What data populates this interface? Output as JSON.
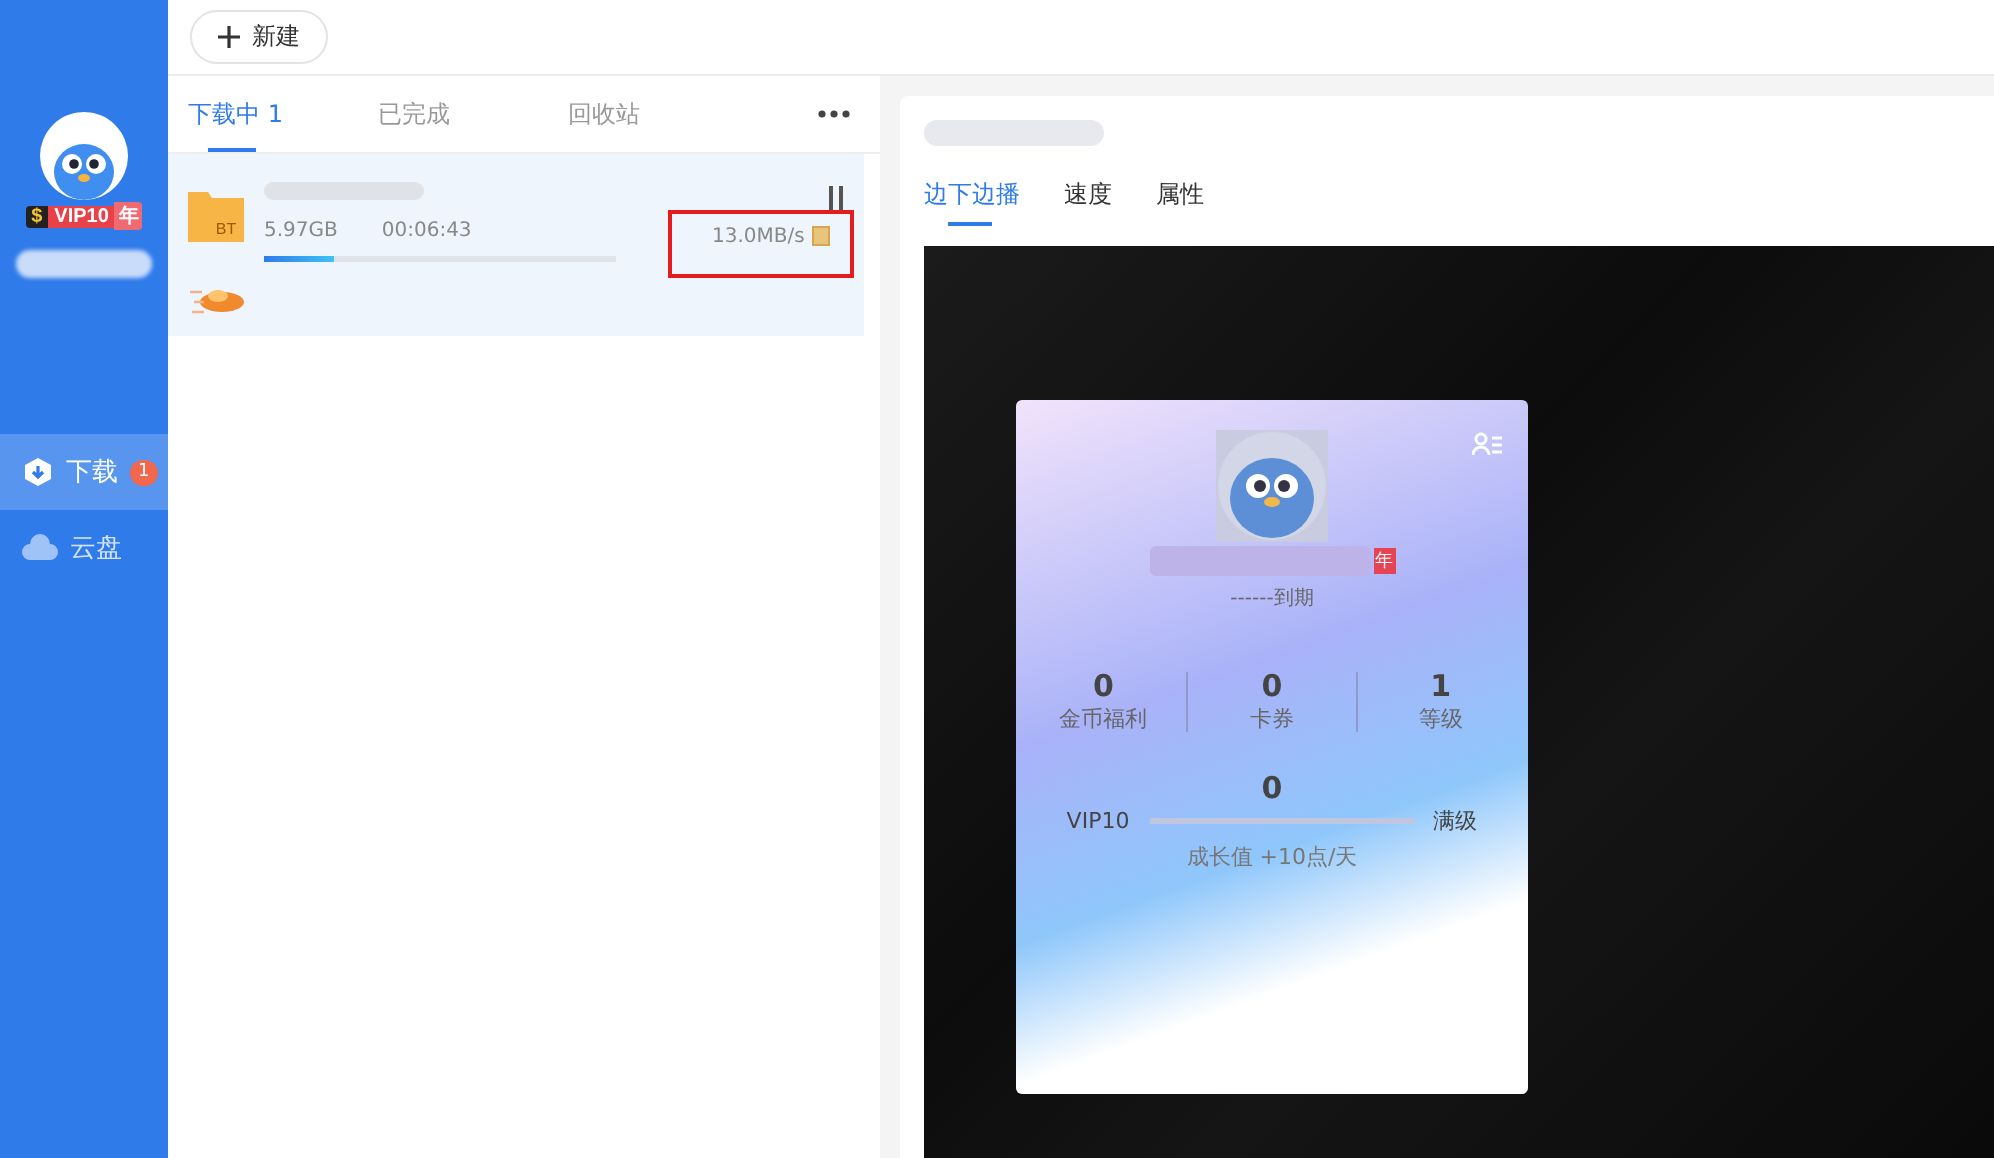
{
  "toolbar": {
    "new_button": "新建"
  },
  "sidebar": {
    "vip_badge": {
      "coin": "$",
      "level_text": "VIP10",
      "year": "年"
    },
    "items": [
      {
        "label": "下载",
        "badge": "1",
        "selected": true
      },
      {
        "label": "云盘",
        "selected": false
      }
    ]
  },
  "download_tabs": [
    {
      "label": "下载中",
      "count": "1",
      "selected": true
    },
    {
      "label": "已完成",
      "selected": false
    },
    {
      "label": "回收站",
      "selected": false
    }
  ],
  "task": {
    "file_type": "BT",
    "size": "5.97GB",
    "elapsed": "00:06:43",
    "speed": "13.0MB/s",
    "level": 0.2,
    "speed_highlighted": true
  },
  "detail_tabs": [
    {
      "label": "边下边播",
      "selected": true
    },
    {
      "label": "速度",
      "selected": false
    },
    {
      "label": "属性",
      "selected": false
    }
  ],
  "vip_card": {
    "year": "年",
    "expiry": "------到期",
    "stats": [
      {
        "value": "0",
        "label": "金币福利"
      },
      {
        "value": "0",
        "label": "卡券"
      },
      {
        "value": "1",
        "label": "等级"
      }
    ],
    "growth": {
      "value": "0",
      "from": "VIP10",
      "to": "满级",
      "note": "成长值 +10点/天"
    }
  }
}
